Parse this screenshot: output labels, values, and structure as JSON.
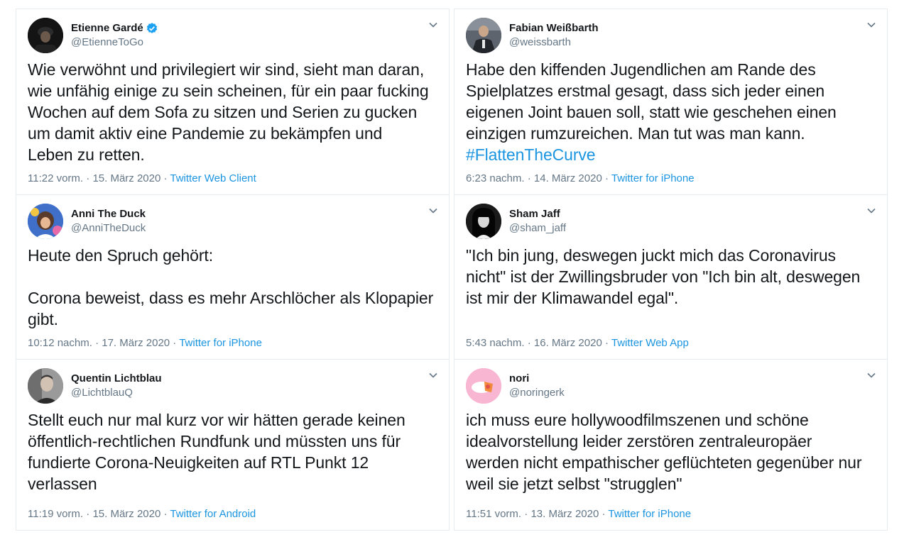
{
  "tweets": [
    {
      "name": "Etienne Gardé",
      "verified": true,
      "handle": "@EtienneToGo",
      "text": "Wie verwöhnt und privilegiert wir sind, sieht man daran,\nwie unfähig einige zu sein scheinen, für ein paar fucking\nWochen auf dem Sofa zu sitzen und Serien zu gucken\num damit aktiv eine Pandemie zu bekämpfen und\nLeben zu retten.",
      "hashtag": "",
      "time": "11:22 vorm.",
      "date": "15. März 2020",
      "source": "Twitter Web Client",
      "avatar_icon": "dark-portrait-avatar",
      "avatar_color": "#1a1a1a"
    },
    {
      "name": "Fabian Weißbarth",
      "verified": false,
      "handle": "@weissbarth",
      "text": "Habe den kiffenden Jugendlichen am Rande des\nSpielplatzes erstmal gesagt, dass sich jeder einen\neigenen Joint bauen soll, statt wie geschehen einen\neinzigen rumzureichen. Man tut was man kann.",
      "hashtag": "#FlattenTheCurve",
      "time": "6:23 nachm.",
      "date": "14. März 2020",
      "source": "Twitter for iPhone",
      "avatar_icon": "suit-portrait-avatar",
      "avatar_color": "#3a3f47"
    },
    {
      "name": "Anni The Duck",
      "verified": false,
      "handle": "@AnniTheDuck",
      "text": "Heute den Spruch gehört:\n\nCorona beweist, dass es mehr Arschlöcher als Klopapier\ngibt.",
      "hashtag": "",
      "time": "10:12 nachm.",
      "date": "17. März 2020",
      "source": "Twitter for iPhone",
      "avatar_icon": "colorful-portrait-avatar",
      "avatar_color": "#4a7fd1"
    },
    {
      "name": "Sham Jaff",
      "verified": false,
      "handle": "@sham_jaff",
      "text": "\"Ich bin jung, deswegen juckt mich das Coronavirus\nnicht\" ist der Zwillingsbruder von \"Ich bin alt, deswegen\nist mir der Klimawandel egal\".",
      "hashtag": "",
      "time": "5:43 nachm.",
      "date": "16. März 2020",
      "source": "Twitter Web App",
      "avatar_icon": "bw-portrait-avatar",
      "avatar_color": "#111111"
    },
    {
      "name": "Quentin Lichtblau",
      "verified": false,
      "handle": "@LichtblauQ",
      "text": "Stellt euch nur mal kurz vor wir hätten gerade keinen\nöffentlich-rechtlichen Rundfunk und müssten uns für\nfundierte Corona-Neuigkeiten auf RTL Punkt 12\nverlassen",
      "hashtag": "",
      "time": "11:19 vorm.",
      "date": "15. März 2020",
      "source": "Twitter for Android",
      "avatar_icon": "grey-portrait-avatar",
      "avatar_color": "#5a5a5a"
    },
    {
      "name": "nori",
      "verified": false,
      "handle": "@noringerk",
      "text": "ich muss eure hollywoodfilmszenen und schöne\nidealvorstellung leider zerstören zentraleuropäer\nwerden nicht empathischer geflüchteten gegenüber nur\nweil sie jetzt selbst \"strugglen\"",
      "hashtag": "",
      "time": "11:51 vorm.",
      "date": "13. März 2020",
      "source": "Twitter for iPhone",
      "avatar_icon": "pink-illustration-avatar",
      "avatar_color": "#f7a8c8"
    }
  ],
  "separator": " · ",
  "colors": {
    "text": "#14171a",
    "secondary": "#657786",
    "link": "#1b95e0",
    "verified": "#1da1f2",
    "border": "#e6ecf0"
  }
}
